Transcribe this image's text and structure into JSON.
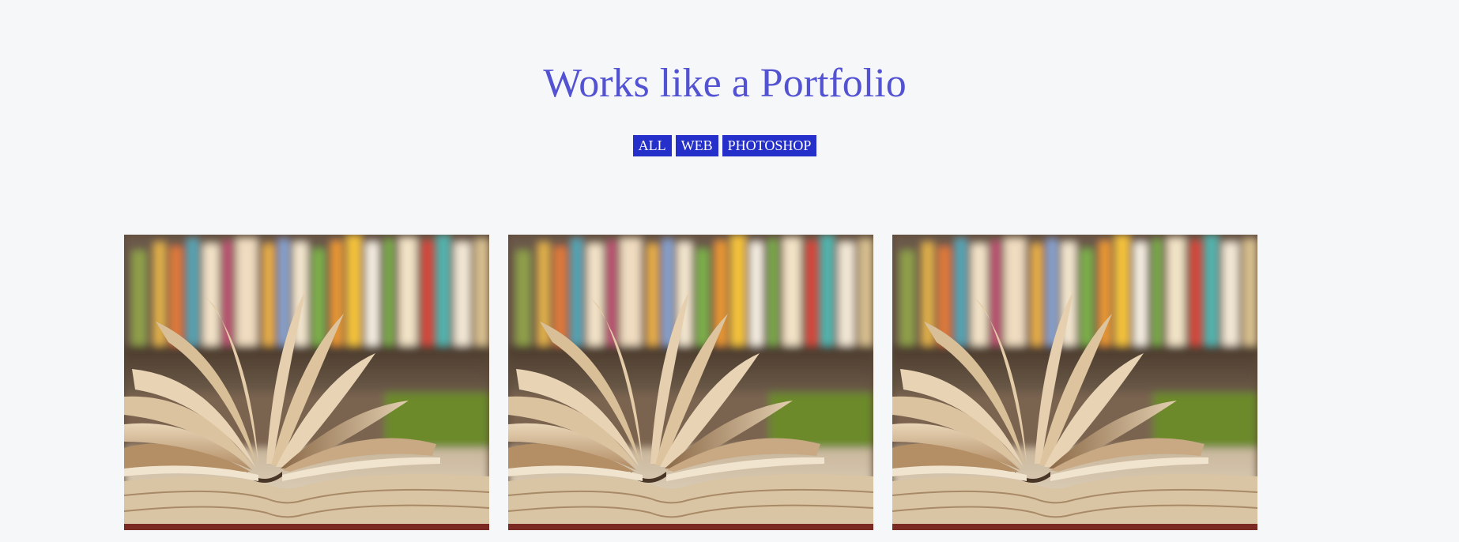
{
  "page": {
    "title": "Works like a Portfolio",
    "title_color": "#5252d2",
    "background": "#f6f7f9"
  },
  "filters": {
    "button_color": "#2430c9",
    "items": [
      {
        "label": "ALL"
      },
      {
        "label": "WEB"
      },
      {
        "label": "PHOTOSHOP"
      }
    ]
  },
  "gallery": {
    "items": [
      {
        "image": "open-book-on-shelf-photo"
      },
      {
        "image": "open-book-on-shelf-photo"
      },
      {
        "image": "open-book-on-shelf-photo"
      }
    ]
  }
}
